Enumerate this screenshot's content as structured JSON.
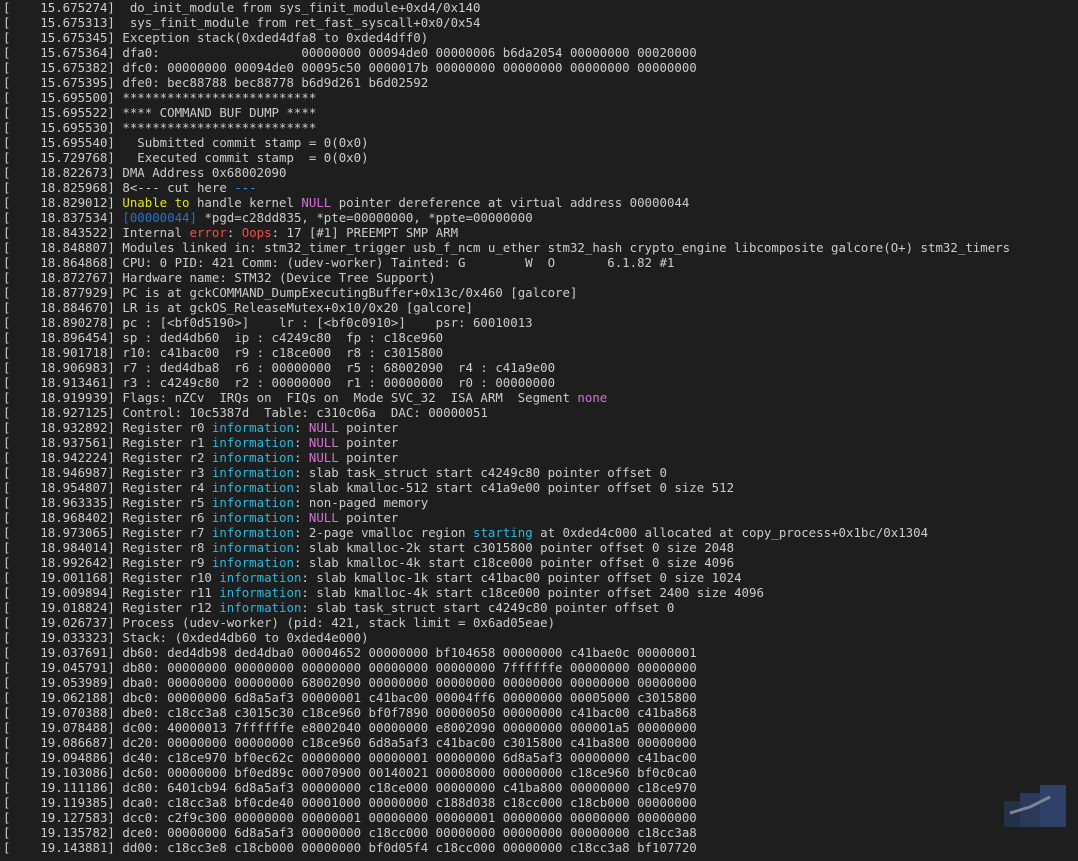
{
  "terminal": {
    "lines": [
      [
        [
          "[    15.675274]  do_init_module from sys_finit_module+0xd4/0x140",
          ""
        ]
      ],
      [
        [
          "[    15.675313]  sys_finit_module from ret_fast_syscall+0x0/0x54",
          ""
        ]
      ],
      [
        [
          "[    15.675345] Exception stack(0xded4dfa8 to 0xded4dff0)",
          ""
        ]
      ],
      [
        [
          "[    15.675364] dfa0:                   00000000 00094de0 00000006 b6da2054 00000000 00020000",
          ""
        ]
      ],
      [
        [
          "[    15.675382] dfc0: 00000000 00094de0 00095c50 0000017b 00000000 00000000 00000000 00000000",
          ""
        ]
      ],
      [
        [
          "[    15.675395] dfe0: bec88788 bec88778 b6d9d261 b6d02592",
          ""
        ]
      ],
      [
        [
          "[    15.695500] **************************",
          ""
        ]
      ],
      [
        [
          "[    15.695522] **** COMMAND BUF DUMP ****",
          ""
        ]
      ],
      [
        [
          "[    15.695530] **************************",
          ""
        ]
      ],
      [
        [
          "[    15.695540]   Submitted commit stamp = 0(0x0)",
          ""
        ]
      ],
      [
        [
          "[    15.729768]   Executed commit stamp  = 0(0x0)",
          ""
        ]
      ],
      [
        [
          "[    18.822673] DMA Address 0x68002090",
          ""
        ]
      ],
      [
        [
          "[    18.825968] 8<--- cut here ",
          ""
        ],
        [
          "---",
          "hl-blue"
        ]
      ],
      [
        [
          "[    18.829012] ",
          ""
        ],
        [
          "Unable to",
          "hl-yellow"
        ],
        [
          " handle kernel ",
          ""
        ],
        [
          "NULL",
          "hl-magenta"
        ],
        [
          " pointer dereference at virtual address 00000044",
          ""
        ]
      ],
      [
        [
          "[    18.837534] ",
          ""
        ],
        [
          "[00000044]",
          "hl-dblue"
        ],
        [
          " *pgd=c28dd835, *pte=00000000, *ppte=00000000",
          ""
        ]
      ],
      [
        [
          "[    18.843522] Internal ",
          ""
        ],
        [
          "error",
          "hl-red"
        ],
        [
          ": ",
          ""
        ],
        [
          "Oops",
          "hl-red"
        ],
        [
          ": 17 [#1] PREEMPT SMP ARM",
          ""
        ]
      ],
      [
        [
          "[    18.848807] Modules linked in: stm32_timer_trigger usb_f_ncm u_ether stm32_hash crypto_engine libcomposite galcore(O+) stm32_timers",
          ""
        ]
      ],
      [
        [
          "[    18.864868] CPU: 0 PID: 421 Comm: (udev-worker) Tainted: G        W  O       6.1.82 #1",
          ""
        ]
      ],
      [
        [
          "[    18.872767] Hardware name: STM32 (Device Tree Support)",
          ""
        ]
      ],
      [
        [
          "[    18.877929] PC is at gckCOMMAND_DumpExecutingBuffer+0x13c/0x460 [galcore]",
          ""
        ]
      ],
      [
        [
          "[    18.884670] LR is at gckOS_ReleaseMutex+0x10/0x20 [galcore]",
          ""
        ]
      ],
      [
        [
          "[    18.890278] pc : [<bf0d5190>]    lr : [<bf0c0910>]    psr: 60010013",
          ""
        ]
      ],
      [
        [
          "[    18.896454] sp : ded4db60  ip : c4249c80  fp : c18ce960",
          ""
        ]
      ],
      [
        [
          "[    18.901718] r10: c41bac00  r9 : c18ce000  r8 : c3015800",
          ""
        ]
      ],
      [
        [
          "[    18.906983] r7 : ded4dba8  r6 : 00000000  r5 : 68002090  r4 : c41a9e00",
          ""
        ]
      ],
      [
        [
          "[    18.913461] r3 : c4249c80  r2 : 00000000  r1 : 00000000  r0 : 00000000",
          ""
        ]
      ],
      [
        [
          "[    18.919939] Flags: nZCv  IRQs on  FIQs on  Mode SVC_32  ISA ARM  Segment ",
          ""
        ],
        [
          "none",
          "hl-magenta"
        ]
      ],
      [
        [
          "[    18.927125] Control: 10c5387d  Table: c310c06a  DAC: 00000051",
          ""
        ]
      ],
      [
        [
          "[    18.932892] Register r0 ",
          ""
        ],
        [
          "information",
          "hl-cyan"
        ],
        [
          ": ",
          ""
        ],
        [
          "NULL",
          "hl-magenta"
        ],
        [
          " pointer",
          ""
        ]
      ],
      [
        [
          "[    18.937561] Register r1 ",
          ""
        ],
        [
          "information",
          "hl-cyan"
        ],
        [
          ": ",
          ""
        ],
        [
          "NULL",
          "hl-magenta"
        ],
        [
          " pointer",
          ""
        ]
      ],
      [
        [
          "[    18.942224] Register r2 ",
          ""
        ],
        [
          "information",
          "hl-cyan"
        ],
        [
          ": ",
          ""
        ],
        [
          "NULL",
          "hl-magenta"
        ],
        [
          " pointer",
          ""
        ]
      ],
      [
        [
          "[    18.946987] Register r3 ",
          ""
        ],
        [
          "information",
          "hl-cyan"
        ],
        [
          ": slab task_struct start c4249c80 pointer offset 0",
          ""
        ]
      ],
      [
        [
          "[    18.954807] Register r4 ",
          ""
        ],
        [
          "information",
          "hl-cyan"
        ],
        [
          ": slab kmalloc-512 start c41a9e00 pointer offset 0 size 512",
          ""
        ]
      ],
      [
        [
          "[    18.963335] Register r5 ",
          ""
        ],
        [
          "information",
          "hl-cyan"
        ],
        [
          ": non-paged memory",
          ""
        ]
      ],
      [
        [
          "[    18.968402] Register r6 ",
          ""
        ],
        [
          "information",
          "hl-cyan"
        ],
        [
          ": ",
          ""
        ],
        [
          "NULL",
          "hl-magenta"
        ],
        [
          " pointer",
          ""
        ]
      ],
      [
        [
          "[    18.973065] Register r7 ",
          ""
        ],
        [
          "information",
          "hl-cyan"
        ],
        [
          ": 2-page vmalloc region ",
          ""
        ],
        [
          "starting",
          "hl-cyan"
        ],
        [
          " at 0xded4c000 allocated at copy_process+0x1bc/0x1304",
          ""
        ]
      ],
      [
        [
          "[    18.984014] Register r8 ",
          ""
        ],
        [
          "information",
          "hl-cyan"
        ],
        [
          ": slab kmalloc-2k start c3015800 pointer offset 0 size 2048",
          ""
        ]
      ],
      [
        [
          "[    18.992642] Register r9 ",
          ""
        ],
        [
          "information",
          "hl-cyan"
        ],
        [
          ": slab kmalloc-4k start c18ce000 pointer offset 0 size 4096",
          ""
        ]
      ],
      [
        [
          "[    19.001168] Register r10 ",
          ""
        ],
        [
          "information",
          "hl-cyan"
        ],
        [
          ": slab kmalloc-1k start c41bac00 pointer offset 0 size 1024",
          ""
        ]
      ],
      [
        [
          "[    19.009894] Register r11 ",
          ""
        ],
        [
          "information",
          "hl-cyan"
        ],
        [
          ": slab kmalloc-4k start c18ce000 pointer offset 2400 size 4096",
          ""
        ]
      ],
      [
        [
          "[    19.018824] Register r12 ",
          ""
        ],
        [
          "information",
          "hl-cyan"
        ],
        [
          ": slab task_struct start c4249c80 pointer offset 0",
          ""
        ]
      ],
      [
        [
          "[    19.026737] Process (udev-worker) (pid: 421, stack limit = 0x6ad05eae)",
          ""
        ]
      ],
      [
        [
          "[    19.033323] Stack: (0xded4db60 to 0xded4e000)",
          ""
        ]
      ],
      [
        [
          "[    19.037691] db60: ded4db98 ded4dba0 00004652 00000000 bf104658 00000000 c41bae0c 00000001",
          ""
        ]
      ],
      [
        [
          "[    19.045791] db80: 00000000 00000000 00000000 00000000 00000000 7ffffffe 00000000 00000000",
          ""
        ]
      ],
      [
        [
          "[    19.053989] dba0: 00000000 00000000 68002090 00000000 00000000 00000000 00000000 00000000",
          ""
        ]
      ],
      [
        [
          "[    19.062188] dbc0: 00000000 6d8a5af3 00000001 c41bac00 00004ff6 00000000 00005000 c3015800",
          ""
        ]
      ],
      [
        [
          "[    19.070388] dbe0: c18cc3a8 c3015c30 c18ce960 bf0f7890 00000050 00000000 c41bac00 c41ba868",
          ""
        ]
      ],
      [
        [
          "[    19.078488] dc00: 40000013 7ffffffe e8002040 00000000 e8002090 00000000 000001a5 00000000",
          ""
        ]
      ],
      [
        [
          "[    19.086687] dc20: 00000000 00000000 c18ce960 6d8a5af3 c41bac00 c3015800 c41ba800 00000000",
          ""
        ]
      ],
      [
        [
          "[    19.094886] dc40: c18ce970 bf0ec62c 00000000 00000001 00000000 6d8a5af3 00000000 c41bac00",
          ""
        ]
      ],
      [
        [
          "[    19.103086] dc60: 00000000 bf0ed89c 00070900 00140021 00008000 00000000 c18ce960 bf0c0ca0",
          ""
        ]
      ],
      [
        [
          "[    19.111186] dc80: 6401cb94 6d8a5af3 00000000 c18ce000 00000000 c41ba800 00000000 c18ce970",
          ""
        ]
      ],
      [
        [
          "[    19.119385] dca0: c18cc3a8 bf0cde40 00001000 00000000 c188d038 c18cc000 c18cb000 00000000",
          ""
        ]
      ],
      [
        [
          "[    19.127583] dcc0: c2f9c300 00000000 00000001 00000000 00000001 00000000 00000000 00000000",
          ""
        ]
      ],
      [
        [
          "[    19.135782] dce0: 00000000 6d8a5af3 00000000 c18cc000 00000000 00000000 00000000 c18cc3a8",
          ""
        ]
      ],
      [
        [
          "[    19.143881] dd00: c18cc3e8 c18cb000 00000000 bf0d05f4 c18cc000 00000000 c18cc3a8 bf107720",
          ""
        ]
      ]
    ]
  },
  "colors": {
    "background": "#1e1e1e",
    "text": "#cccccc",
    "yellow": "#e5e510",
    "magenta": "#d670d6",
    "red": "#f14c4c",
    "cyan": "#29b8db",
    "blue": "#3b8eea"
  }
}
